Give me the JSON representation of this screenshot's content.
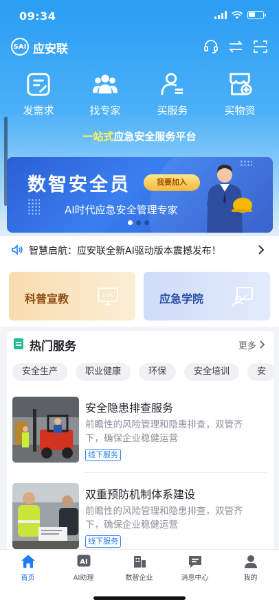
{
  "status_bar": {
    "time": "09:34"
  },
  "header": {
    "app_name": "应安联",
    "logo_text": "SAI"
  },
  "quick_actions": [
    {
      "label": "发需求",
      "icon": "edit-doc-icon"
    },
    {
      "label": "找专家",
      "icon": "experts-icon"
    },
    {
      "label": "买服务",
      "icon": "service-person-icon"
    },
    {
      "label": "买物资",
      "icon": "shop-icon"
    }
  ],
  "platform": {
    "highlight": "一站式",
    "rest": "应急安全服务平台"
  },
  "banner": {
    "title": "数智安全员",
    "button": "我要加入",
    "subtitle": "AI时代应急安全管理专家",
    "pages": 3,
    "active_page": 1
  },
  "notice": {
    "text": "智慧启航：应安联全新AI驱动版本震撼发布！"
  },
  "features": [
    {
      "label": "科普宣教",
      "icon": "live-tv-icon",
      "icon_text": "LIVE"
    },
    {
      "label": "应急学院",
      "icon": "teacher-board-icon"
    }
  ],
  "hot_services": {
    "title": "热门服务",
    "more": "更多",
    "tags": [
      "安全生产",
      "职业健康",
      "环保",
      "安全培训",
      "安"
    ],
    "items": [
      {
        "title": "安全隐患排查服务",
        "desc": "前瞻性的风险管理和隐患排查，双管齐下，确保企业稳健运营",
        "tag": "线下服务"
      },
      {
        "title": "双重预防机制体系建设",
        "desc": "前瞻性的风险管理和隐患排查，双管齐下，确保企业稳健运营",
        "tag": "线下服务"
      }
    ]
  },
  "bottom_nav": [
    {
      "label": "首页",
      "icon": "home-icon",
      "active": true
    },
    {
      "label": "AI助理",
      "icon": "ai-icon",
      "icon_text": "AI",
      "active": false
    },
    {
      "label": "数智企业",
      "icon": "building-icon",
      "active": false
    },
    {
      "label": "消息中心",
      "icon": "message-icon",
      "active": false
    },
    {
      "label": "我的",
      "icon": "profile-icon",
      "active": false
    }
  ],
  "colors": {
    "primary": "#2a9df4",
    "active": "#1d7ef2",
    "highlight": "#fff35c",
    "tag_blue": "#2a7ef0"
  }
}
